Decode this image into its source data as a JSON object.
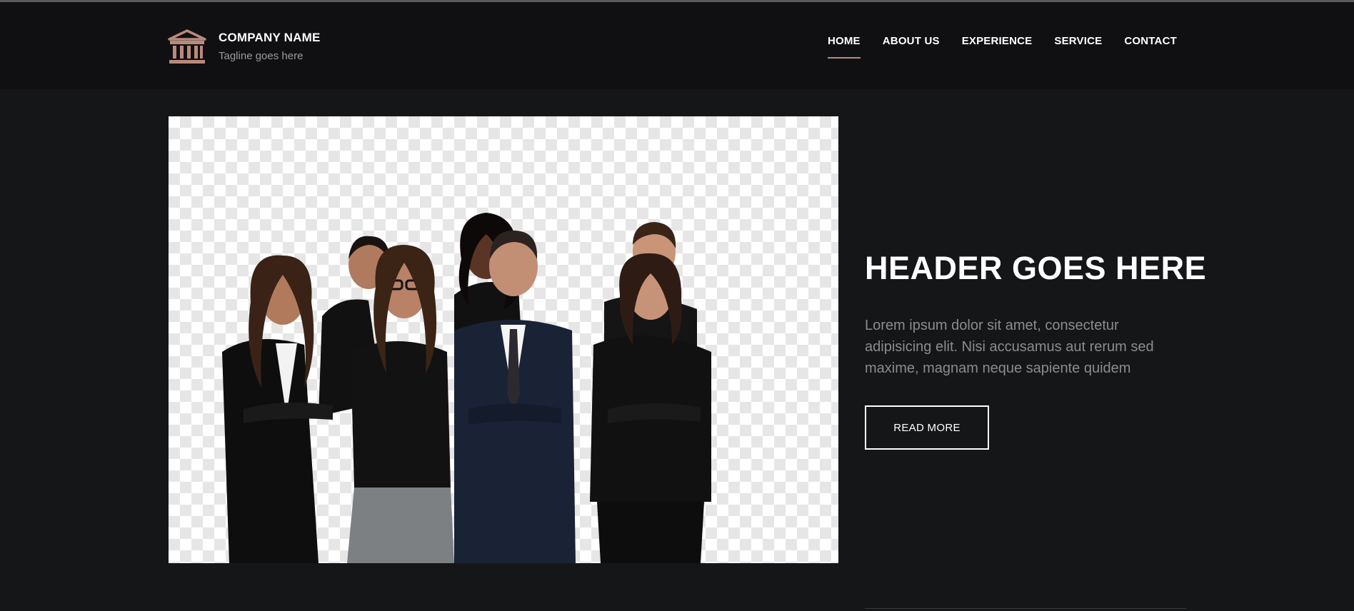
{
  "brand": {
    "name": "COMPANY NAME",
    "tagline": "Tagline goes here",
    "logo_icon": "building-columns-icon",
    "accent_color": "#b88a7c"
  },
  "nav": {
    "items": [
      {
        "label": "HOME",
        "active": true
      },
      {
        "label": "ABOUT US",
        "active": false
      },
      {
        "label": "EXPERIENCE",
        "active": false
      },
      {
        "label": "SERVICE",
        "active": false
      },
      {
        "label": "CONTACT",
        "active": false
      }
    ]
  },
  "hero": {
    "title": "HEADER GOES HERE",
    "text": "Lorem ipsum dolor sit amet, consectetur adipisicing elit. Nisi accusamus aut rerum sed maxime, magnam neque sapiente quidem",
    "button_label": "READ MORE",
    "image": "group-of-business-people-photo"
  },
  "colors": {
    "page_background": "#151618",
    "header_background": "#101012",
    "text_primary": "#ffffff",
    "text_muted": "#8c8c8e"
  }
}
